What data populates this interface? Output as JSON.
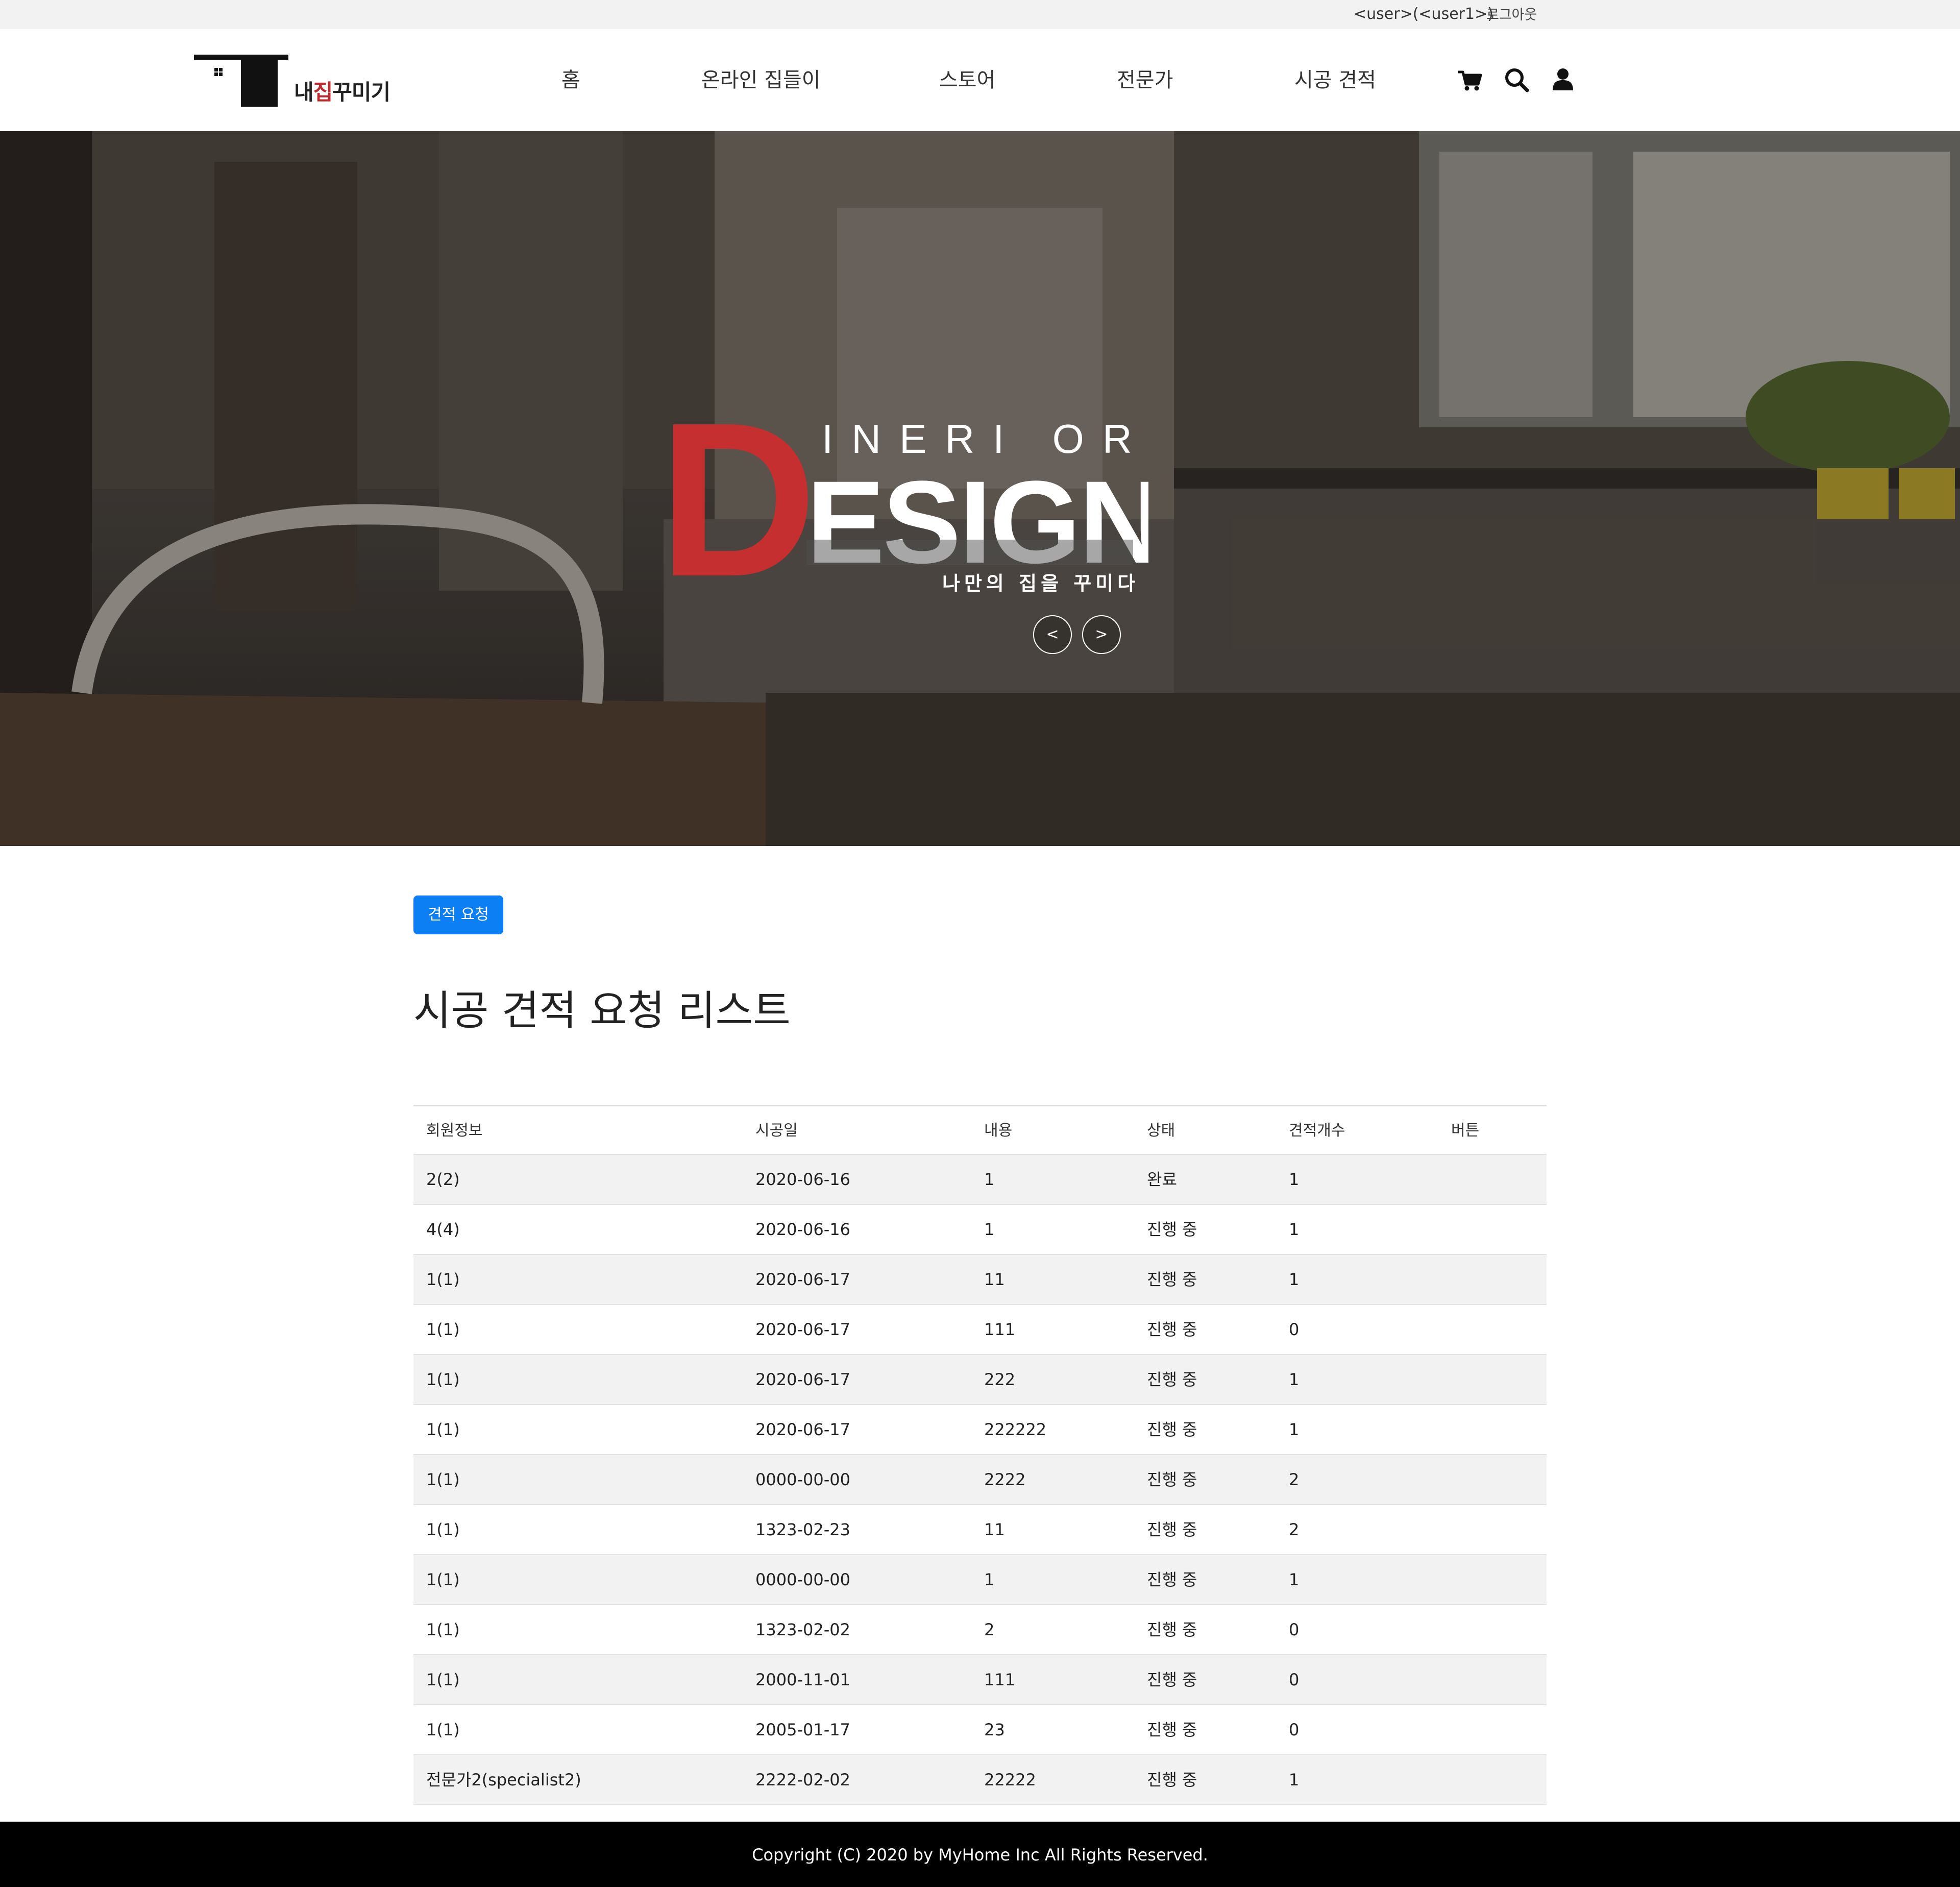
{
  "topbar": {
    "user_text": "<user>(<user1>)",
    "logout_label": "로그아웃"
  },
  "header": {
    "logo": {
      "brand_part1": "내",
      "brand_part2": "집",
      "brand_part3": "꾸미기"
    },
    "nav": [
      {
        "label": "홈"
      },
      {
        "label": "온라인 집들이"
      },
      {
        "label": "스토어"
      },
      {
        "label": "전문가"
      },
      {
        "label": "시공 견적"
      }
    ],
    "icons": [
      "cart-icon",
      "search-icon",
      "user-icon"
    ]
  },
  "hero": {
    "logo_letter": "D",
    "logo_top": "INERI OR",
    "logo_main": "ESIGN",
    "tagline": "나만의 집을 꾸미다",
    "prev_label": "<",
    "next_label": ">",
    "accent_color": "#c62f2f"
  },
  "main": {
    "request_button": "견적 요청",
    "title": "시공 견적 요청 리스트",
    "table": {
      "headers": [
        "회원정보",
        "시공일",
        "내용",
        "상태",
        "견적개수",
        "버튼"
      ],
      "rows": [
        [
          "2(2)",
          "2020-06-16",
          "1",
          "완료",
          "1",
          ""
        ],
        [
          "4(4)",
          "2020-06-16",
          "1",
          "진행 중",
          "1",
          ""
        ],
        [
          "1(1)",
          "2020-06-17",
          "11",
          "진행 중",
          "1",
          ""
        ],
        [
          "1(1)",
          "2020-06-17",
          "111",
          "진행 중",
          "0",
          ""
        ],
        [
          "1(1)",
          "2020-06-17",
          "222",
          "진행 중",
          "1",
          ""
        ],
        [
          "1(1)",
          "2020-06-17",
          "222222",
          "진행 중",
          "1",
          ""
        ],
        [
          "1(1)",
          "0000-00-00",
          "2222",
          "진행 중",
          "2",
          ""
        ],
        [
          "1(1)",
          "1323-02-23",
          "11",
          "진행 중",
          "2",
          ""
        ],
        [
          "1(1)",
          "0000-00-00",
          "1",
          "진행 중",
          "1",
          ""
        ],
        [
          "1(1)",
          "1323-02-02",
          "2",
          "진행 중",
          "0",
          ""
        ],
        [
          "1(1)",
          "2000-11-01",
          "111",
          "진행 중",
          "0",
          ""
        ],
        [
          "1(1)",
          "2005-01-17",
          "23",
          "진행 중",
          "0",
          ""
        ],
        [
          "전문가2(specialist2)",
          "2222-02-02",
          "22222",
          "진행 중",
          "1",
          ""
        ]
      ]
    }
  },
  "footer": {
    "copyright": "Copyright (C) 2020 by MyHome Inc All Rights Reserved."
  },
  "colors": {
    "primary_button": "#0d7ff5",
    "stripe": "#f2f2f2",
    "footer_bg": "#000000"
  }
}
